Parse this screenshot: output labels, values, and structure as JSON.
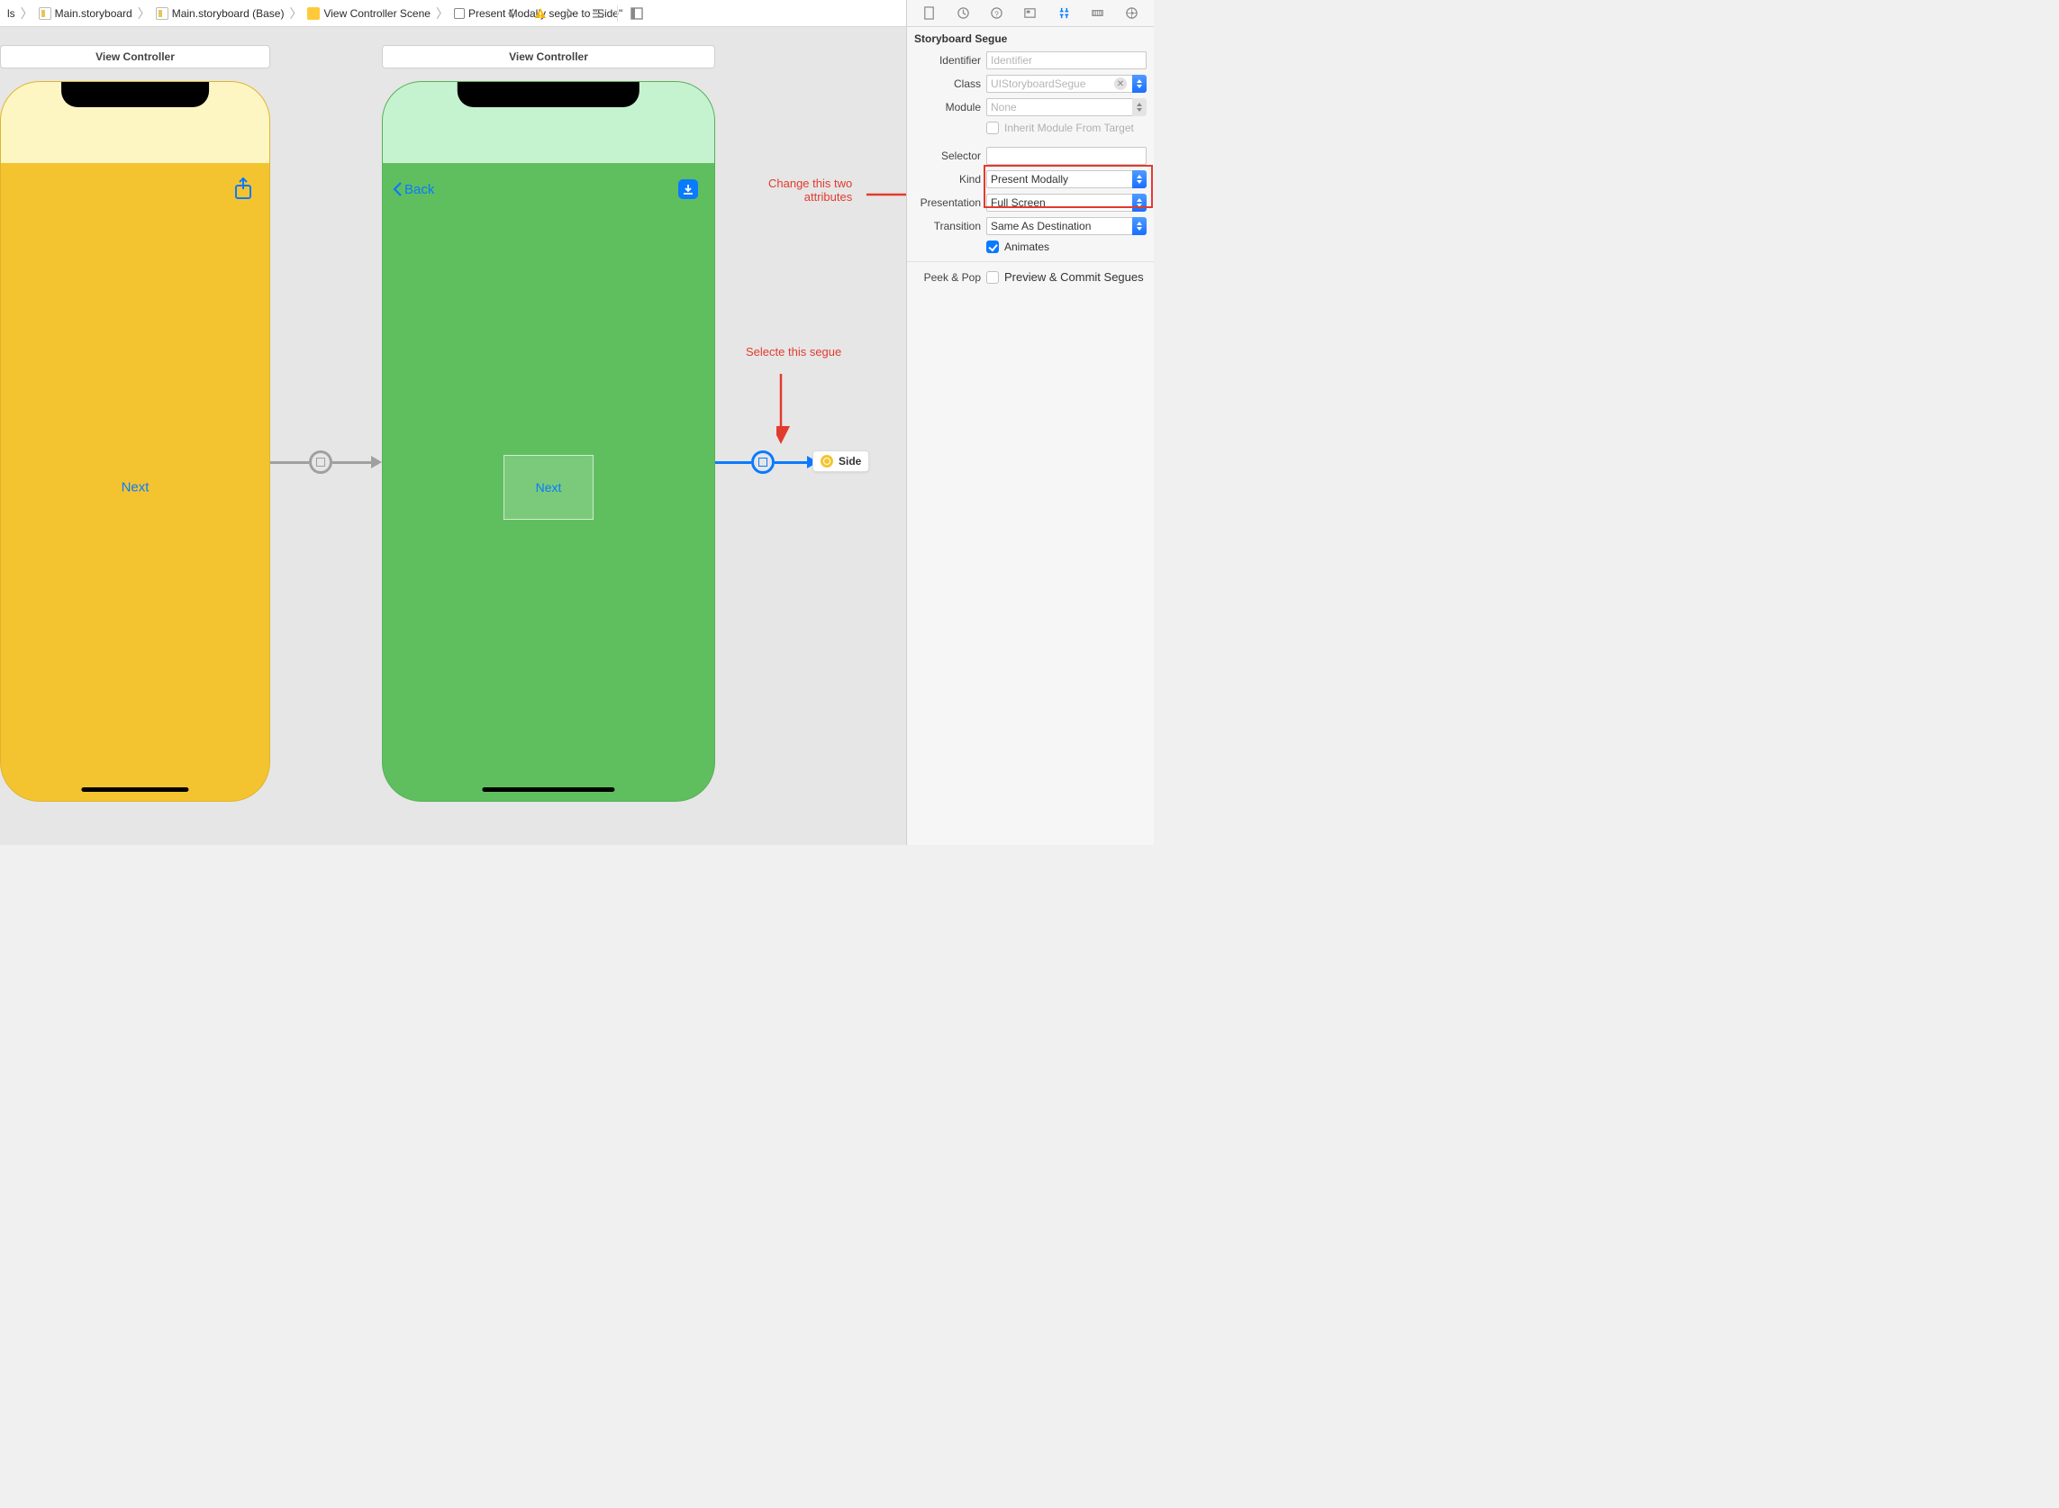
{
  "breadcrumb": {
    "items": [
      {
        "label": "ls"
      },
      {
        "label": "Main.storyboard"
      },
      {
        "label": "Main.storyboard (Base)"
      },
      {
        "label": "View Controller Scene"
      },
      {
        "label": "Present Modally segue to \"Side\""
      }
    ]
  },
  "canvas": {
    "scene1_title": "View Controller",
    "scene2_title": "View Controller",
    "scene1_next": "Next",
    "scene2_back": "Back",
    "scene2_next": "Next",
    "side_ref": "Side"
  },
  "annotations": {
    "select_segue": "Selecte this segue",
    "change_attrs_line1": "Change this two",
    "change_attrs_line2": "attributes"
  },
  "inspector": {
    "section_title": "Storyboard Segue",
    "fields": {
      "identifier_label": "Identifier",
      "identifier_placeholder": "Identifier",
      "class_label": "Class",
      "class_value": "UIStoryboardSegue",
      "module_label": "Module",
      "module_value": "None",
      "inherit_label": "Inherit Module From Target",
      "selector_label": "Selector",
      "selector_value": "",
      "kind_label": "Kind",
      "kind_value": "Present Modally",
      "presentation_label": "Presentation",
      "presentation_value": "Full Screen",
      "transition_label": "Transition",
      "transition_value": "Same As Destination",
      "animates_label": "Animates",
      "peekpop_label": "Peek & Pop",
      "preview_label": "Preview & Commit Segues"
    }
  }
}
